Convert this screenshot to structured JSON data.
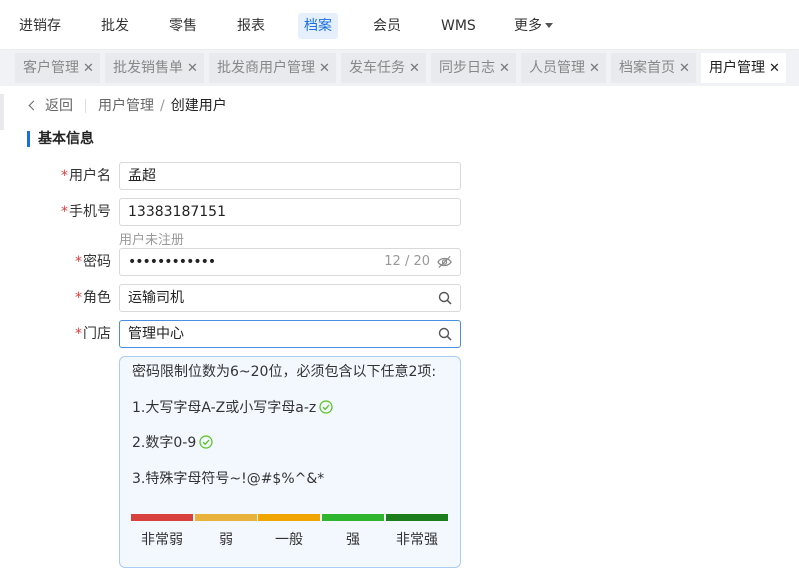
{
  "top_menu": {
    "items": [
      "进销存",
      "批发",
      "零售",
      "报表",
      "档案",
      "会员",
      "WMS",
      "更多"
    ],
    "active_index": 4
  },
  "tabs": {
    "items": [
      "客户管理",
      "批发销售单",
      "批发商用户管理",
      "发车任务",
      "同步日志",
      "人员管理",
      "档案首页",
      "用户管理"
    ],
    "active_index": 7,
    "close_glyph": "✕"
  },
  "breadcrumb": {
    "back_label": "返回",
    "parent": "用户管理",
    "separator": "/",
    "current": "创建用户"
  },
  "section_title": "基本信息",
  "form": {
    "required_mark": "*",
    "username": {
      "label": "用户名",
      "value": "孟超"
    },
    "phone": {
      "label": "手机号",
      "value": "13383187151",
      "hint": "用户未注册"
    },
    "password": {
      "label": "密码",
      "value": "••••••••••••",
      "counter": "12 / 20"
    },
    "role": {
      "label": "角色",
      "value": "运输司机"
    },
    "store": {
      "label": "门店",
      "value": "管理中心"
    }
  },
  "password_rules": {
    "intro": "密码限制位数为6~20位，必须包含以下任意2项:",
    "rule1": "1.大写字母A-Z或小写字母a-z",
    "rule2": "2.数字0-9",
    "rule3": "3.特殊字母符号~!@#$%^&*",
    "rule1_met": true,
    "rule2_met": true,
    "rule3_met": false,
    "strength_labels": [
      "非常弱",
      "弱",
      "一般",
      "强",
      "非常强"
    ],
    "strength_colors": [
      "#d9413e",
      "#e8b23d",
      "#f0a500",
      "#2fb52f",
      "#1b7d1b"
    ]
  },
  "colors": {
    "accent": "#1a6fe0",
    "required": "#e23b3b",
    "check": "#52c41a"
  }
}
